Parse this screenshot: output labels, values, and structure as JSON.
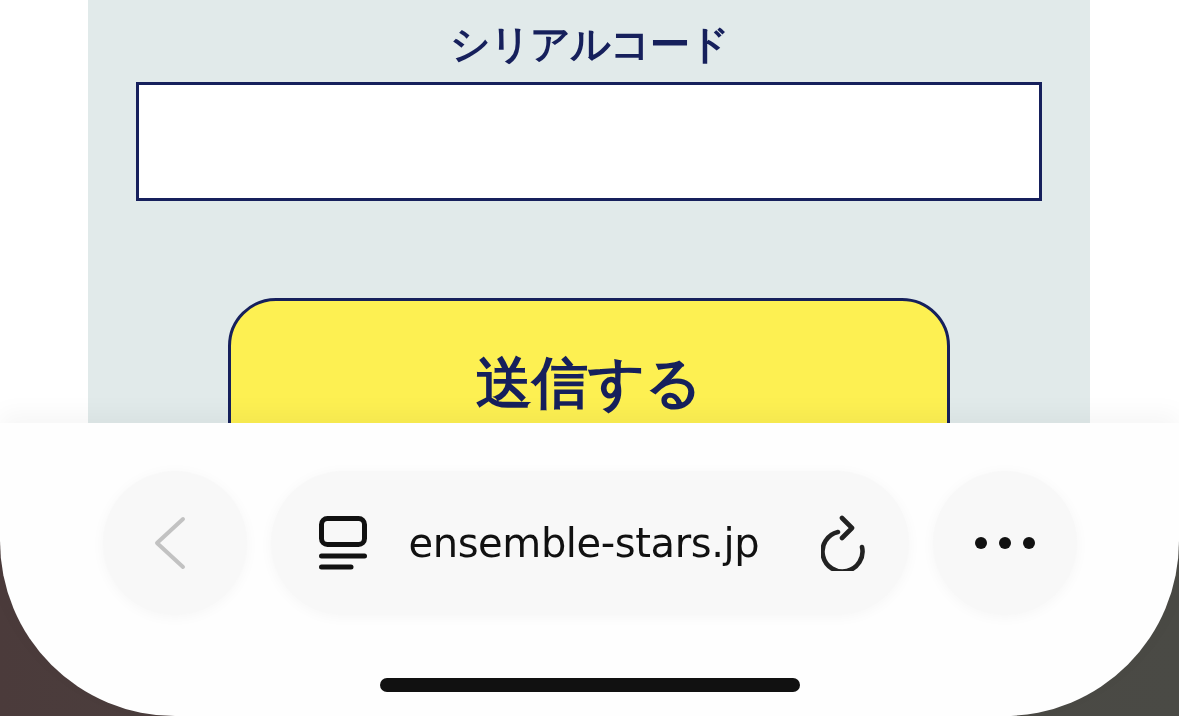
{
  "page": {
    "serial_code": {
      "label": "シリアルコード"
    },
    "submit_button": {
      "label": "送信する"
    }
  },
  "browser_toolbar": {
    "back_button": {
      "disabled": true
    },
    "address_bar": {
      "url": "ensemble-stars.jp"
    }
  }
}
